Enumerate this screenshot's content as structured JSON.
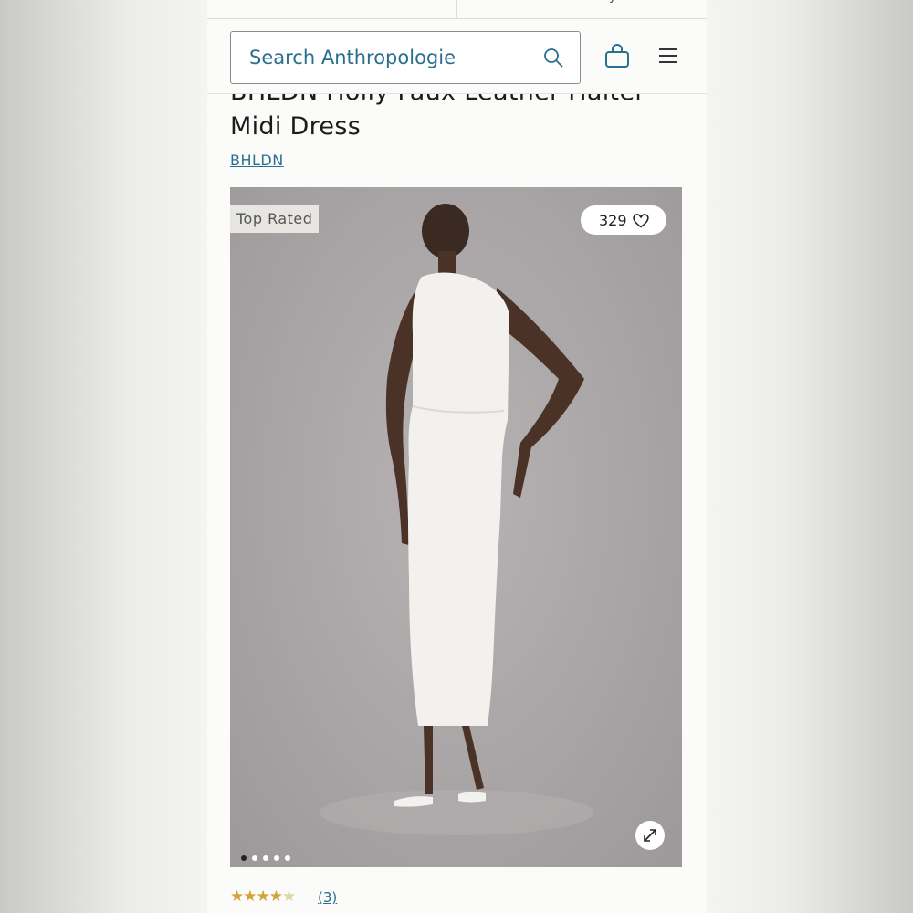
{
  "top_tab_fragment": "y",
  "search": {
    "placeholder": "Search Anthropologie"
  },
  "icons": {
    "search": "search-icon",
    "bag": "shopping-bag-icon",
    "menu": "hamburger-menu-icon",
    "heart": "heart-icon",
    "expand": "expand-icon"
  },
  "product": {
    "title": "BHLDN Holly Faux Leather Halter Midi Dress",
    "brand": "BHLDN",
    "badge": "Top Rated",
    "favorites": "329",
    "image_count": 5,
    "active_image_index": 0,
    "rating": 4.5,
    "review_count": "(3)"
  },
  "colors": {
    "accent": "#2a6f8f",
    "star": "#d3a43a",
    "text": "#1c1c1c"
  }
}
